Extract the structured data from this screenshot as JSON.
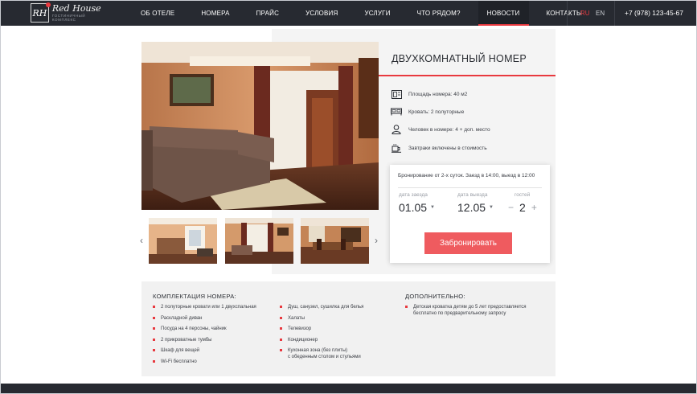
{
  "header": {
    "logo": {
      "title": "Red House",
      "subtitle": "ГОСТИНИЧНЫЙ КОМПЛЕКС",
      "mark": "RH"
    },
    "nav": [
      "ОБ ОТЕЛЕ",
      "НОМЕРА",
      "ПРАЙС",
      "УСЛОВИЯ",
      "УСЛУГИ",
      "ЧТО РЯДОМ?",
      "НОВОСТИ",
      "КОНТАКТЫ"
    ],
    "active_nav": "НОВОСТИ",
    "languages": {
      "ru": "RU",
      "en": "EN",
      "active": "RU"
    },
    "phone": "+7 (978) 123-45-67"
  },
  "room": {
    "title": "ДВУХКОМНАТНЫЙ НОМЕР",
    "features": [
      {
        "icon": "area-icon",
        "text": "Площадь номера: 40 м2"
      },
      {
        "icon": "bed-icon",
        "text": "Кровать: 2 полуторные"
      },
      {
        "icon": "person-icon",
        "text": "Человек в номере: 4 + доп. место"
      },
      {
        "icon": "breakfast-icon",
        "text": "Завтраки включены в стоимость"
      }
    ]
  },
  "booking": {
    "note": "Бронирование от 2-х суток. Заезд в 14:00, выезд в 12:00",
    "checkin_label": "дата заезда",
    "checkin_value": "01.05",
    "checkout_label": "дата выезда",
    "checkout_value": "12.05",
    "guests_label": "гостей",
    "guests_value": "2",
    "minus": "−",
    "plus": "+",
    "button": "Забронировать"
  },
  "gallery": {
    "prev": "‹",
    "next": "›"
  },
  "amenities": {
    "title": "КОМПЛЕКТАЦИЯ НОМЕРА:",
    "col1": [
      "2 полуторные кровати или 1 двухспальная",
      "Раскладной диван",
      "Посуда на 4 персоны, чайник",
      "2 прикроватные тумбы",
      "Шкаф для вещей",
      "Wi-Fi бесплатно"
    ],
    "col2": [
      "Душ, санузел, сушилка для белья",
      "Халаты",
      "Телевизор",
      "Кондиционер",
      "Кухонная зона (без плиты)",
      "с обеденным столом и стульями"
    ],
    "extra_title": "ДОПОЛНИТЕЛЬНО:",
    "extra": [
      "Детская кроватка детям до 5 лет предоставляется",
      "бесплатно по предварительному запросу"
    ]
  },
  "colors": {
    "accent": "#e8393f",
    "button": "#ef5b5f",
    "header": "#272a31"
  }
}
